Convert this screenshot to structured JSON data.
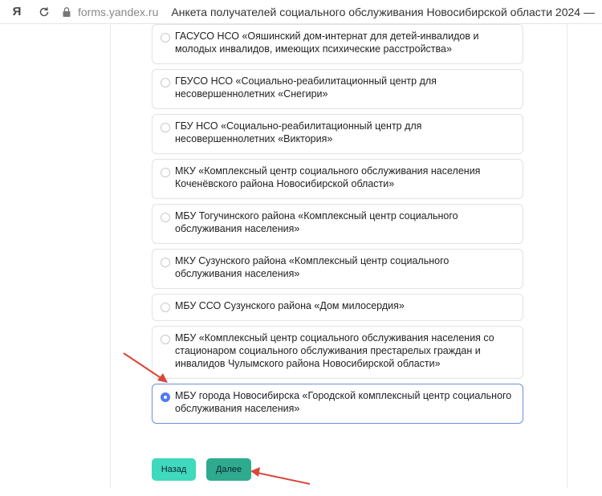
{
  "browser": {
    "logo": "Я",
    "url": "forms.yandex.ru",
    "title": "Анкета получателей социального обслуживания Новосибирской области 2024 — Yan..."
  },
  "options": [
    {
      "label": "ГАСУСО НСО «Ояшинский дом-интернат для детей-инвалидов и молодых инвалидов, имеющих психические расстройства»",
      "selected": false
    },
    {
      "label": "ГБУСО НСО «Социально-реабилитационный центр для несовершеннолетних «Снегири»",
      "selected": false
    },
    {
      "label": "ГБУ НСО «Социально-реабилитационный центр для несовершеннолетних «Виктория»",
      "selected": false
    },
    {
      "label": "МКУ «Комплексный центр социального обслуживания населения Коченёвского района Новосибирской области»",
      "selected": false
    },
    {
      "label": "МБУ Тогучинского района «Комплексный центр социального обслуживания населения»",
      "selected": false
    },
    {
      "label": "МКУ Сузунского района «Комплексный центр социального обслуживания населения»",
      "selected": false
    },
    {
      "label": "МБУ ССО Сузунского района «Дом милосердия»",
      "selected": false
    },
    {
      "label": "МБУ «Комплексный центр социального обслуживания населения со стационаром социального обслуживания престарелых граждан и инвалидов Чулымского района Новосибирской области»",
      "selected": false
    },
    {
      "label": "МБУ города Новосибирска «Городской комплексный центр социального обслуживания населения»",
      "selected": true
    }
  ],
  "buttons": {
    "back_label": "Назад",
    "next_label": "Далее"
  },
  "colors": {
    "selected_radio": "#4f7df0",
    "back_button": "#3fd9bd",
    "next_button": "#2eab8e",
    "annotation_arrow": "#d9473a"
  }
}
